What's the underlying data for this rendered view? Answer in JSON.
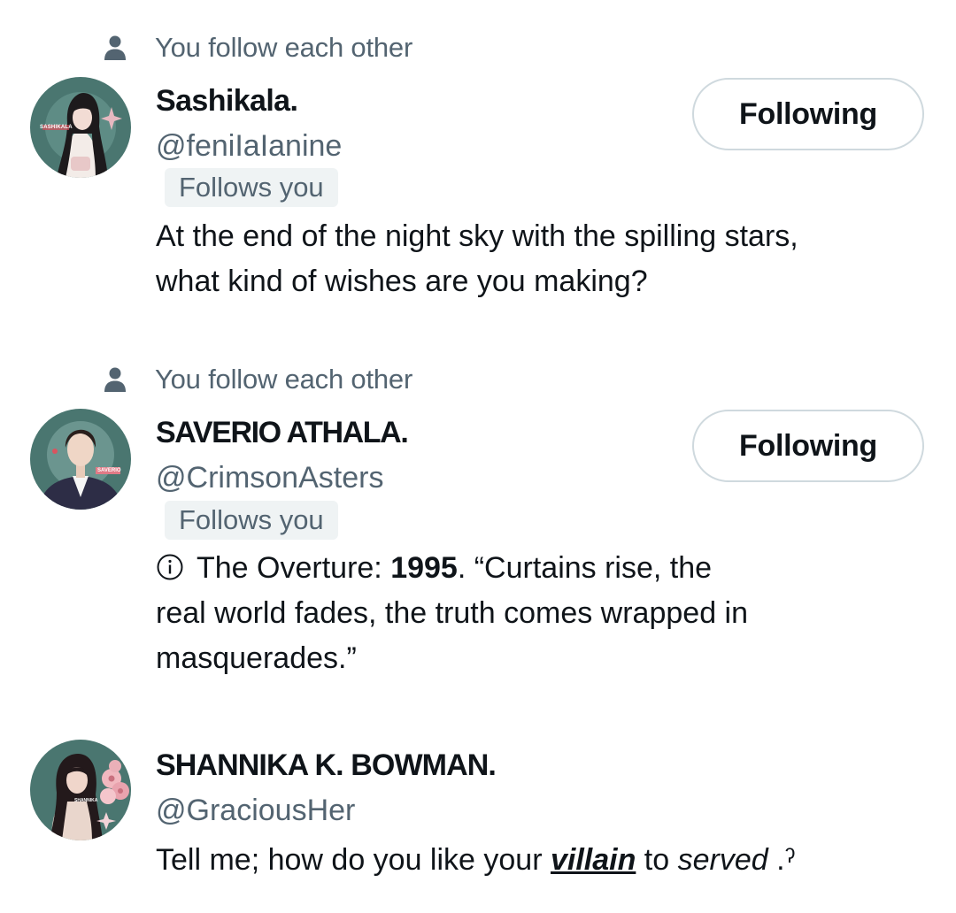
{
  "users": [
    {
      "social_context": "You follow each other",
      "name": "Sashikala.",
      "handle": "@feniIaIanine",
      "follows_you": "Follows you",
      "button_label": "Following",
      "bio_line1": "At the end of the night sky with the spilling stars,",
      "bio_line2": "what kind of wishes are you making?",
      "avatar_text": "SASHIKALA"
    },
    {
      "social_context": "You follow each other",
      "name": "SAVERIO ATHALA.",
      "handle": "@CrimsonAsters",
      "follows_you": "Follows you",
      "button_label": "Following",
      "bio_prefix": "The Overture: ",
      "bio_year": "1995",
      "bio_rest1": ". “Curtains rise, the",
      "bio_line2": "real world fades, the truth comes wrapped in",
      "bio_line3": "masquerades.”",
      "avatar_text": "SAVERIO"
    },
    {
      "name": "SHANNIKA K. BOWMAN.",
      "handle": "@GraciousHer",
      "bio_pre": "Tell me; how do you like your ",
      "bio_villain": "villain",
      "bio_mid": " to ",
      "bio_served": "served",
      "bio_end": " .ˀ",
      "avatar_text": "SHANNIKA"
    }
  ],
  "colors": {
    "primary_text": "#0f1419",
    "secondary_text": "#536471",
    "badge_bg": "#eff3f4",
    "button_border": "#cfd9de",
    "avatar_bg": "#4a7670"
  },
  "icons": {
    "social_context": "person-icon",
    "bio_info": "info-circle-icon"
  }
}
